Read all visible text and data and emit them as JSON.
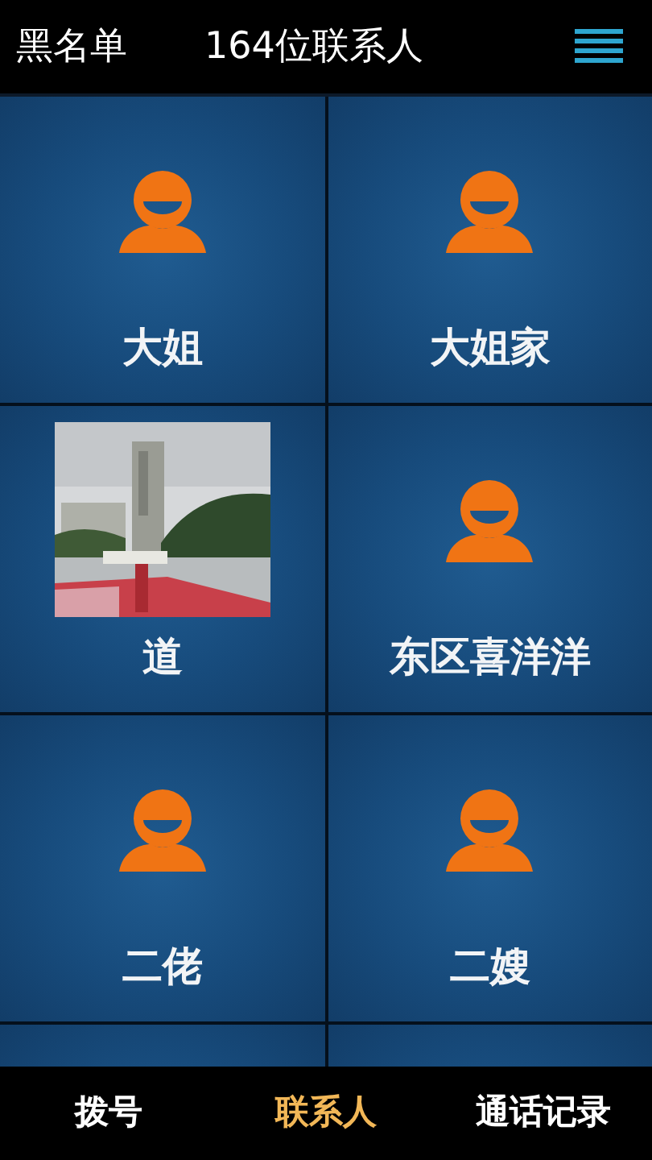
{
  "header": {
    "title": "黑名单",
    "count": "164位联系人"
  },
  "tiles": [
    {
      "kind": "avatar",
      "name": "大姐"
    },
    {
      "kind": "avatar",
      "name": "大姐家"
    },
    {
      "kind": "picture",
      "name": "道"
    },
    {
      "kind": "avatar",
      "name": "东区喜洋洋"
    },
    {
      "kind": "avatar",
      "name": "二佬"
    },
    {
      "kind": "avatar",
      "name": "二嫂"
    },
    {
      "kind": "cut"
    },
    {
      "kind": "cut"
    }
  ],
  "tabs": [
    {
      "label": "拨号",
      "selected": false
    },
    {
      "label": "联系人",
      "selected": true
    },
    {
      "label": "通话记录",
      "selected": false
    }
  ]
}
